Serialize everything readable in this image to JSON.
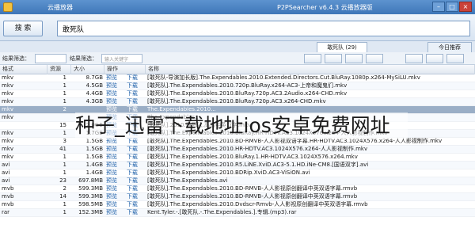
{
  "titlebar": {
    "window_title": "云播放器",
    "app_title": "P2PSearcher v6.4.3 云播放器版",
    "minimize": "–",
    "maximize": "□",
    "close": "×"
  },
  "search": {
    "button_label": "搜 索",
    "query": "敢死队"
  },
  "tabs": [
    {
      "label": "敢死队 (29)"
    },
    {
      "label": "今日推荐"
    }
  ],
  "filter": {
    "label1": "结果筛选：",
    "placeholder1": "",
    "label2": "结果筛选：",
    "placeholder2": "输入关键字"
  },
  "columns": {
    "ext": "格式",
    "seeds": "资源",
    "size": "大小",
    "a1": "操作",
    "name": "名称"
  },
  "rows": [
    {
      "ext": "mkv",
      "seeds": "1",
      "size": "8.7GB",
      "a1": "预览",
      "a2": "下载",
      "name": "[敢死队-导演加长版].The.Expendables.2010.Extended.Directors.Cut.BluRay.1080p.x264-MySiLU.mkv"
    },
    {
      "ext": "mkv",
      "seeds": "1",
      "size": "4.5GB",
      "a1": "预览",
      "a2": "下载",
      "name": "[敢死队].The.Expendables.2010.720p.BluRay.x264-AC3-上帝和魔鬼们.mkv"
    },
    {
      "ext": "mkv",
      "seeds": "1",
      "size": "4.4GB",
      "a1": "预览",
      "a2": "下载",
      "name": "[敢死队].The.Expendables.2010.BluRay.720p.AC3.2Audio.x264-CHD.mkv"
    },
    {
      "ext": "mkv",
      "seeds": "1",
      "size": "4.3GB",
      "a1": "预览",
      "a2": "下载",
      "name": "[敢死队].The.Expendables.2010.BluRay.720p.AC3.x264-CHD.mkv"
    },
    {
      "ext": "mkv",
      "seeds": "2",
      "size": "",
      "a1": "预览",
      "a2": "下载",
      "name": "The.Expendables.2010..."
    },
    {
      "ext": "mkv",
      "seeds": "",
      "size": "",
      "a1": "预览",
      "a2": "下载",
      "name": "The.Expendables..."
    },
    {
      "ext": "",
      "seeds": "15",
      "size": "2.0GB",
      "a1": "预览",
      "a2": "下载",
      "name": "[敢死队].2010.敢死队.高清中英双字.mkv"
    },
    {
      "ext": "mkv",
      "seeds": "1",
      "size": "1.7GB",
      "a1": "预览",
      "a2": "下载",
      "name": "[敢死队].The.Expendables.2010.BluRay.HR-HDTV.AC3.1024X576.x264-人人影视制作.mkv"
    },
    {
      "ext": "mkv",
      "seeds": "3",
      "size": "1.5GB",
      "a1": "预览",
      "a2": "下载",
      "name": "[敢死队].The.Expendables.2010.BD-RMVB-人人影视双语字幕.HR-HDTV.AC3.1024X576.x264-人人影视制作.mkv"
    },
    {
      "ext": "mkv",
      "seeds": "41",
      "size": "1.5GB",
      "a1": "预览",
      "a2": "下载",
      "name": "[敢死队].The.Expendables.2010.HR-HDTV.AC3.1024X576.x264-人人影视制作.mkv"
    },
    {
      "ext": "mkv",
      "seeds": "1",
      "size": "1.5GB",
      "a1": "预览",
      "a2": "下载",
      "name": "[敢死队].The.Expendables.2010.BluRay.1.HR-HDTV.AC3.1024X576.x264.mkv"
    },
    {
      "ext": "avi",
      "seeds": "1",
      "size": "1.4GB",
      "a1": "预览",
      "a2": "下载",
      "name": "[敢死队].The.Expendables.2010.R5.LiNE.XviD.AC3-5.1.HD.iNe-CM8.[国语双字].avi"
    },
    {
      "ext": "avi",
      "seeds": "1",
      "size": "1.4GB",
      "a1": "预览",
      "a2": "下载",
      "name": "[敢死队].The.Expendables.2010.BDRip.XviD.AC3-ViSiON.avi"
    },
    {
      "ext": "avi",
      "seeds": "23",
      "size": "697.8MB",
      "a1": "预览",
      "a2": "下载",
      "name": "[敢死队].The.Expendables.avi"
    },
    {
      "ext": "mvb",
      "seeds": "2",
      "size": "599.3MB",
      "a1": "预览",
      "a2": "下载",
      "name": "[敢死队].The.Expendables.2010.BD-RMVB-人人影视原创翻译中英双语字幕.rmvb"
    },
    {
      "ext": "mvb",
      "seeds": "14",
      "size": "599.3MB",
      "a1": "预览",
      "a2": "下载",
      "name": "[敢死队].The.Expendables.2010.BD-RMVB-人人影视原创翻译中英双语字幕.rmvb"
    },
    {
      "ext": "mvb",
      "seeds": "1",
      "size": "598.5MB",
      "a1": "预览",
      "a2": "下载",
      "name": "[敢死队].The.Expendables.2010.Dvdscr-Rmvb-人人影视原创翻译中英双语字幕.rmvb"
    },
    {
      "ext": "rar",
      "seeds": "1",
      "size": "152.3MB",
      "a1": "预览",
      "a2": "下载",
      "name": "Kent.Tyler.-.[敢死队.-.The.Expendables.].专辑.(mp3).rar"
    }
  ],
  "overlay": "种子_迅雷下载地址ios安卓免费网址"
}
